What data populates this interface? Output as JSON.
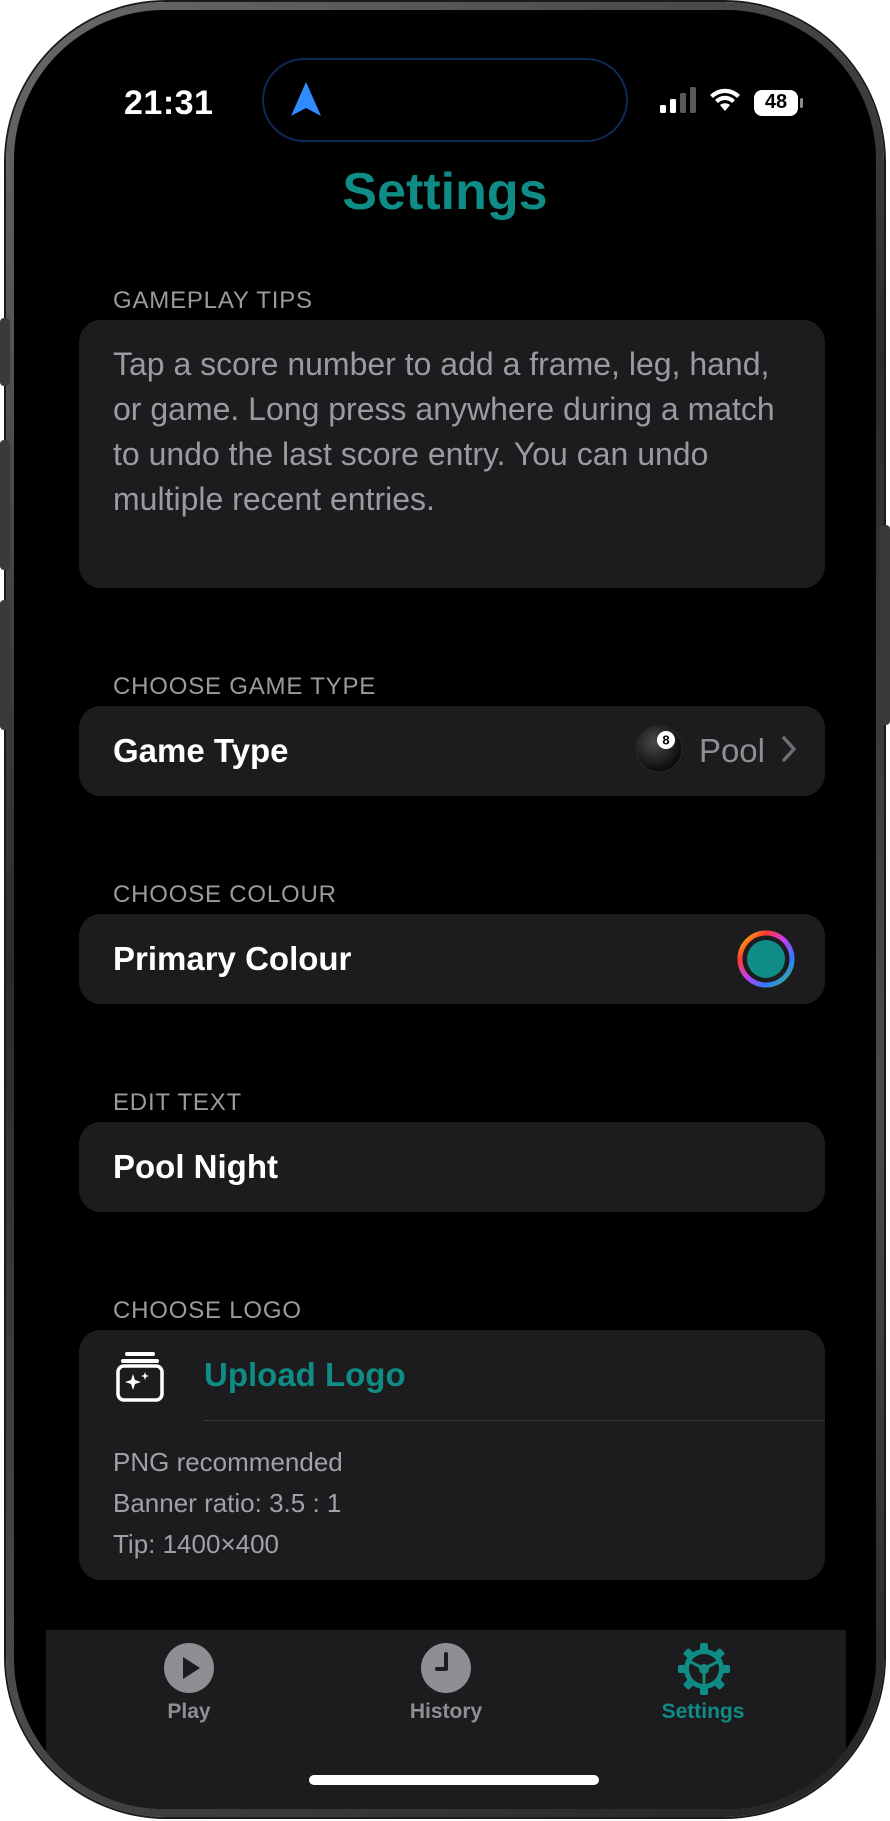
{
  "status_bar": {
    "time": "21:31",
    "battery": "48"
  },
  "page": {
    "title": "Settings",
    "accent_color": "#0f8c85"
  },
  "sections": {
    "tips": {
      "header": "GAMEPLAY TIPS",
      "text": "Tap a score number to add a frame, leg, hand, or game. Long press anywhere during a match to undo the last score entry. You can undo multiple recent entries."
    },
    "game_type": {
      "header": "CHOOSE GAME TYPE",
      "label": "Game Type",
      "value": "Pool",
      "ball_number": "8"
    },
    "colour": {
      "header": "CHOOSE COLOUR",
      "label": "Primary Colour",
      "selected_color": "#0f8c85"
    },
    "text": {
      "header": "EDIT TEXT",
      "value": "Pool Night"
    },
    "logo": {
      "header": "CHOOSE LOGO",
      "upload_label": "Upload Logo",
      "notes": [
        "PNG recommended",
        "Banner ratio: 3.5 : 1",
        "Tip: 1400×400"
      ]
    }
  },
  "tab_bar": {
    "tabs": [
      {
        "label": "Play",
        "icon": "play-icon",
        "active": false
      },
      {
        "label": "History",
        "icon": "clock-icon",
        "active": false
      },
      {
        "label": "Settings",
        "icon": "gear-icon",
        "active": true
      }
    ]
  }
}
